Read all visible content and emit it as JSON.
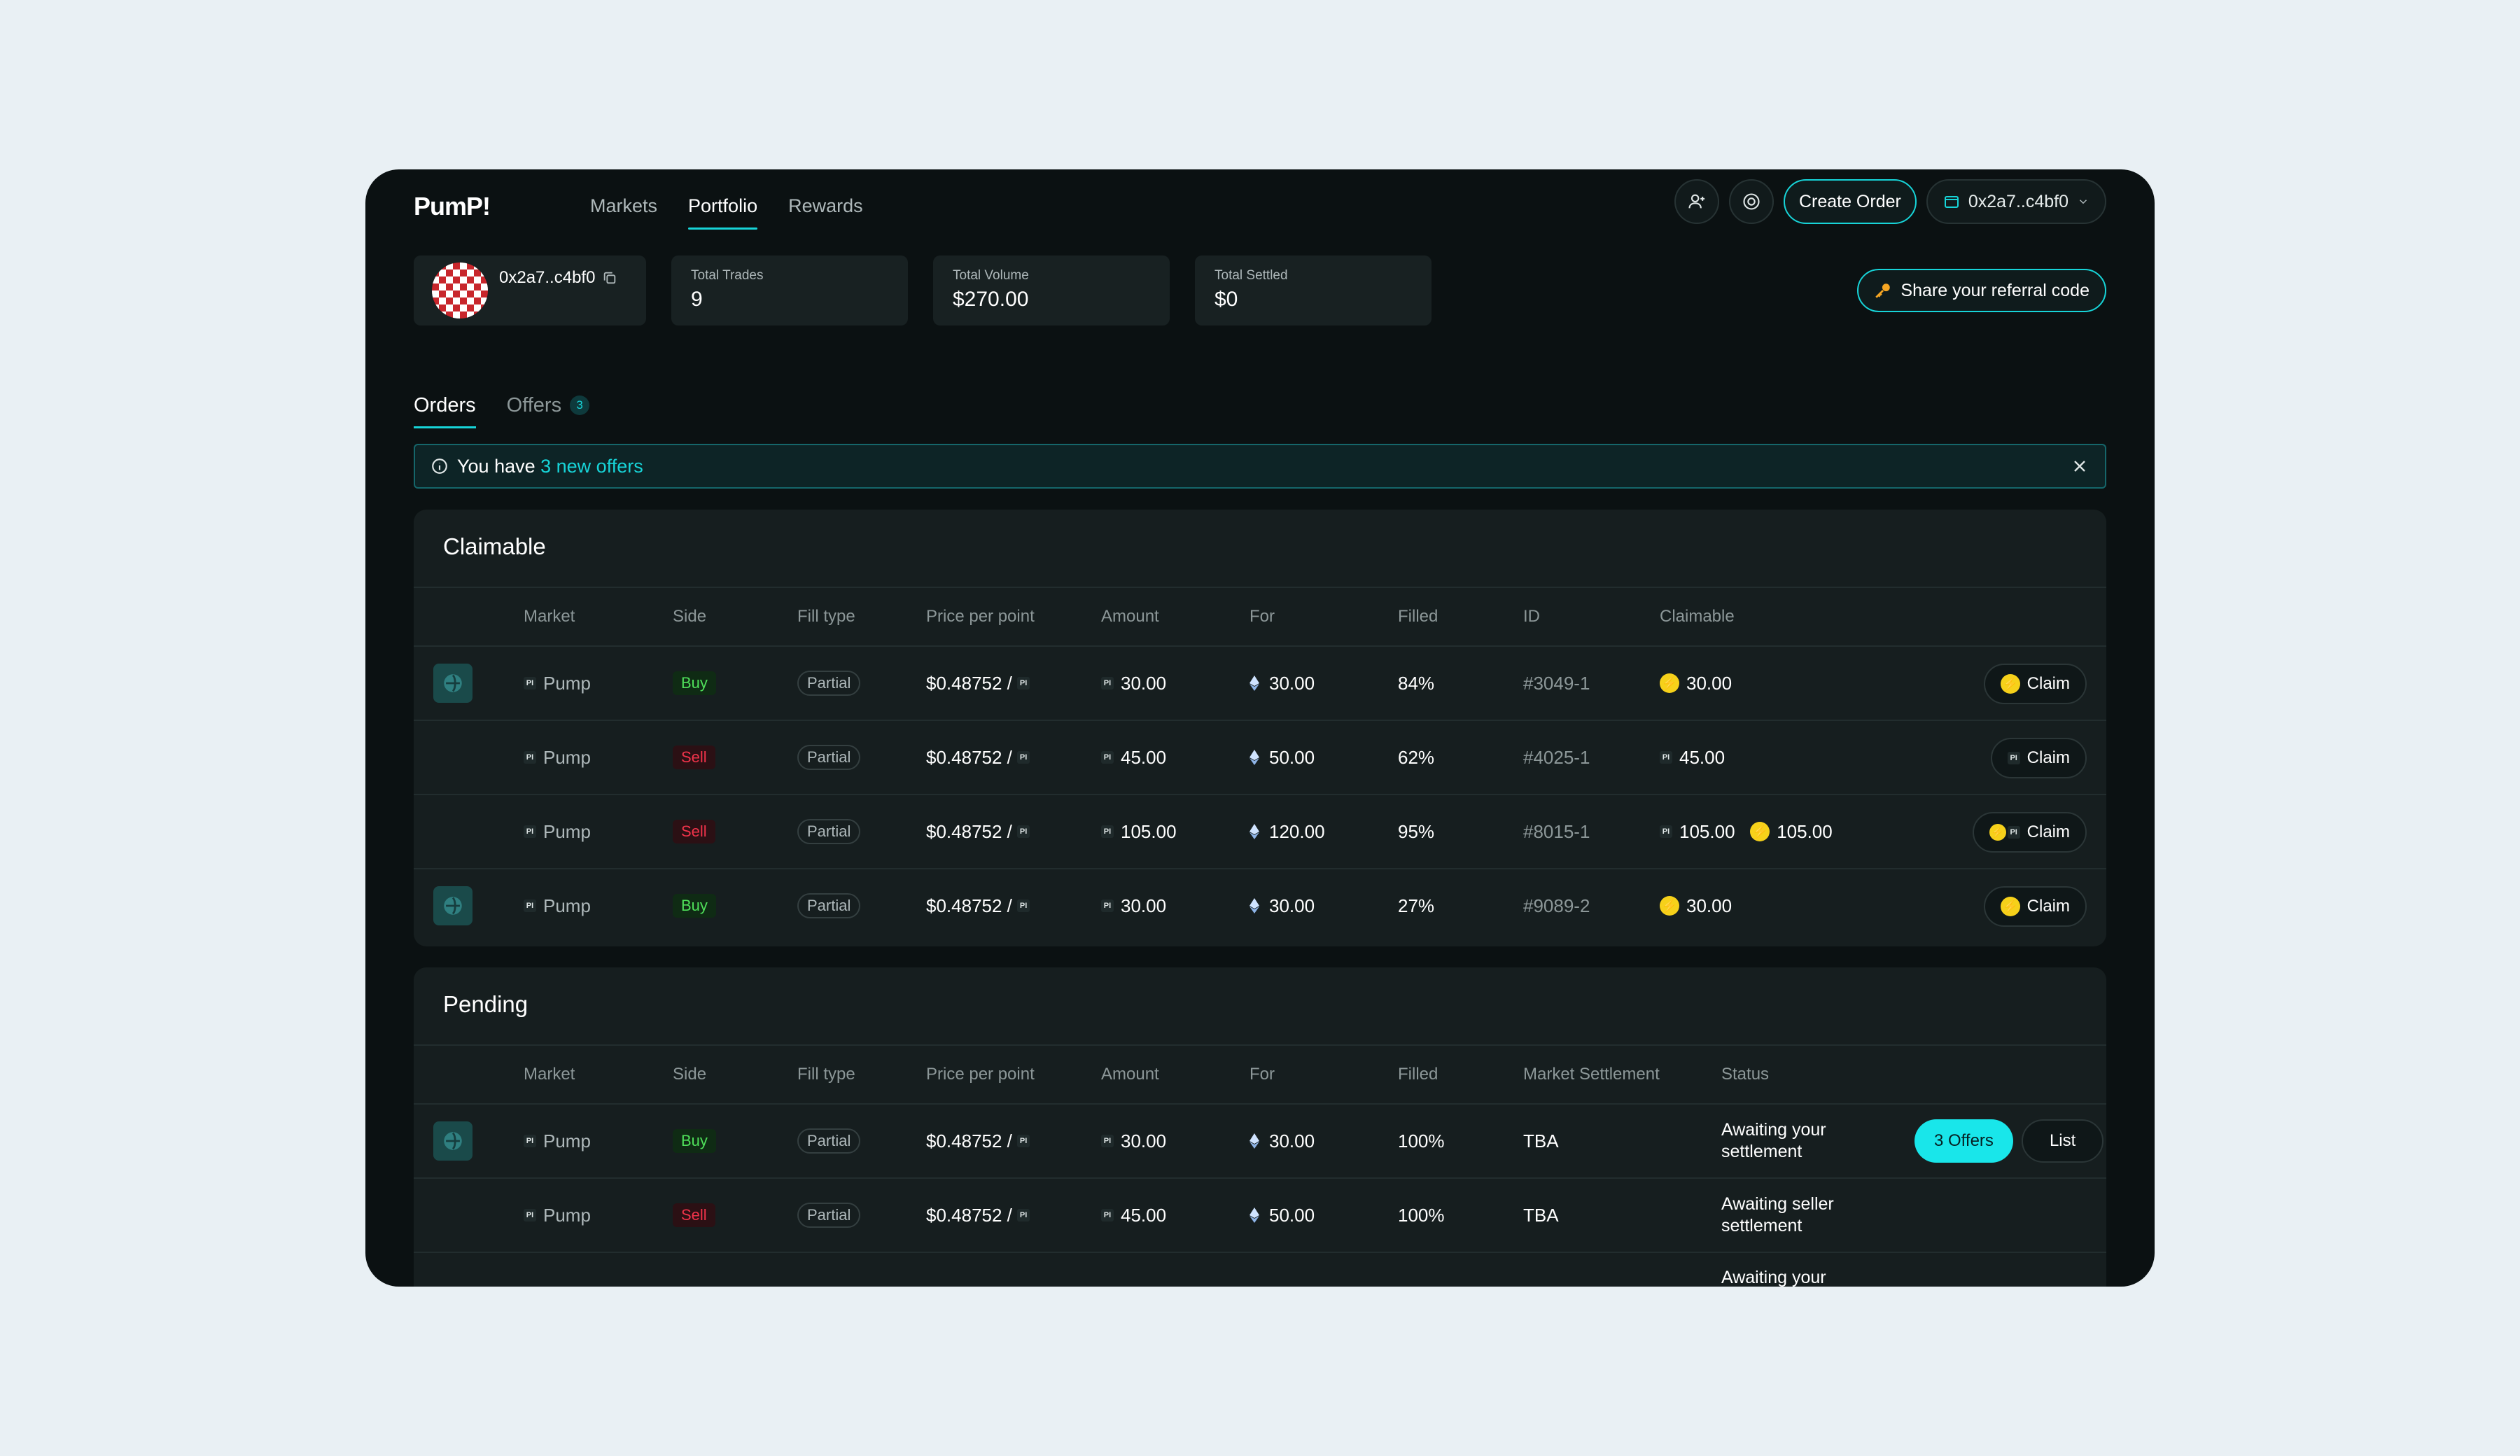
{
  "brand": {
    "logo": "PumP!"
  },
  "nav": {
    "markets": "Markets",
    "portfolio": "Portfolio",
    "rewards": "Rewards"
  },
  "header": {
    "create_order": "Create Order",
    "wallet": "0x2a7..c4bf0"
  },
  "user": {
    "address": "0x2a7..c4bf0"
  },
  "stats": [
    {
      "label": "Total Trades",
      "value": "9"
    },
    {
      "label": "Total Volume",
      "value": "$270.00"
    },
    {
      "label": "Total Settled",
      "value": "$0"
    }
  ],
  "referral": "Share your referral code",
  "tabs": {
    "orders": "Orders",
    "offers": "Offers",
    "offers_count": "3"
  },
  "banner": {
    "prefix": "You have ",
    "highlight": "3 new offers"
  },
  "claimable": {
    "title": "Claimable",
    "headers": {
      "market": "Market",
      "side": "Side",
      "fill_type": "Fill type",
      "price": "Price per point",
      "amount": "Amount",
      "for": "For",
      "filled": "Filled",
      "id": "ID",
      "claimable": "Claimable"
    },
    "rows": [
      {
        "market": "Pump",
        "side": "Buy",
        "fill": "Partial",
        "price": "$0.48752 /",
        "amount": "30.00",
        "for": "30.00",
        "filled": "84%",
        "id": "#3049-1",
        "claim1": "30.00",
        "claim2": "",
        "btn": "Claim"
      },
      {
        "market": "Pump",
        "side": "Sell",
        "fill": "Partial",
        "price": "$0.48752 /",
        "amount": "45.00",
        "for": "50.00",
        "filled": "62%",
        "id": "#4025-1",
        "claim1": "45.00",
        "claim2": "",
        "btn": "Claim"
      },
      {
        "market": "Pump",
        "side": "Sell",
        "fill": "Partial",
        "price": "$0.48752 /",
        "amount": "105.00",
        "for": "120.00",
        "filled": "95%",
        "id": "#8015-1",
        "claim1": "105.00",
        "claim2": "105.00",
        "btn": "Claim"
      },
      {
        "market": "Pump",
        "side": "Buy",
        "fill": "Partial",
        "price": "$0.48752 /",
        "amount": "30.00",
        "for": "30.00",
        "filled": "27%",
        "id": "#9089-2",
        "claim1": "30.00",
        "claim2": "",
        "btn": "Claim"
      }
    ]
  },
  "pending": {
    "title": "Pending",
    "headers": {
      "market": "Market",
      "side": "Side",
      "fill_type": "Fill type",
      "price": "Price per point",
      "amount": "Amount",
      "for": "For",
      "filled": "Filled",
      "settlement": "Market Settlement",
      "status": "Status"
    },
    "rows": [
      {
        "market": "Pump",
        "side": "Buy",
        "fill": "Partial",
        "price": "$0.48752 /",
        "amount": "30.00",
        "for": "30.00",
        "filled": "100%",
        "settlement": "TBA",
        "status": "Awaiting your settlement",
        "offers_btn": "3 Offers",
        "list_btn": "List"
      },
      {
        "market": "Pump",
        "side": "Sell",
        "fill": "Partial",
        "price": "$0.48752 /",
        "amount": "45.00",
        "for": "50.00",
        "filled": "100%",
        "settlement": "TBA",
        "status": "Awaiting seller settlement"
      },
      {
        "status": "Awaiting your"
      }
    ]
  },
  "icons": {
    "pi_glyph": "PI",
    "bolt_glyph": "⚡"
  },
  "colors": {
    "accent": "#17d4d8",
    "buy": "#4fe05a",
    "sell": "#f0334a",
    "bg": "#0b1112",
    "panel": "#161e1f"
  }
}
